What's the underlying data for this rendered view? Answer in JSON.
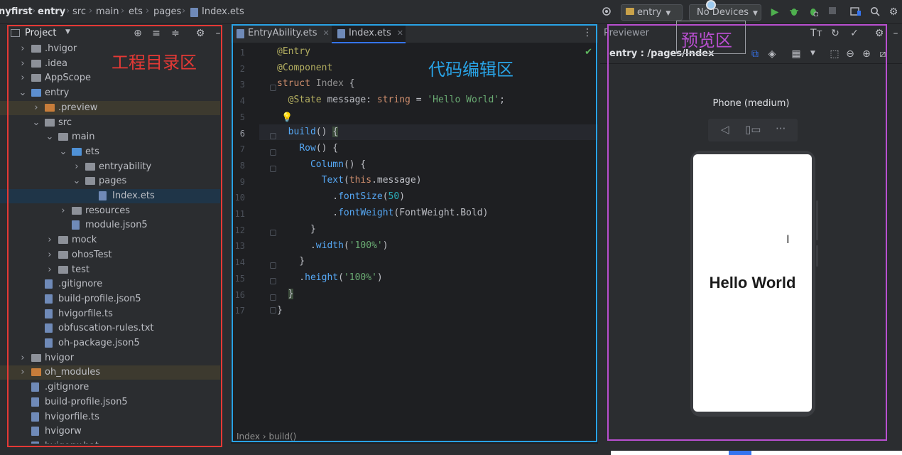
{
  "breadcrumb": {
    "items": [
      "nyfirst",
      "entry",
      "src",
      "main",
      "ets",
      "pages",
      "Index.ets"
    ]
  },
  "toolbar": {
    "module_combo": "entry",
    "device_combo": "No Devices"
  },
  "project_panel": {
    "title": "Project",
    "tree": [
      {
        "label": ".hvigor",
        "kind": "folder",
        "expanded": false,
        "depth": 1
      },
      {
        "label": ".idea",
        "kind": "folder",
        "expanded": false,
        "depth": 1
      },
      {
        "label": "AppScope",
        "kind": "folder",
        "expanded": false,
        "depth": 1
      },
      {
        "label": "entry",
        "kind": "module",
        "expanded": true,
        "depth": 1
      },
      {
        "label": ".preview",
        "kind": "folder-orange",
        "expanded": false,
        "depth": 2,
        "highlight": "orange"
      },
      {
        "label": "src",
        "kind": "folder",
        "expanded": true,
        "depth": 2
      },
      {
        "label": "main",
        "kind": "folder",
        "expanded": true,
        "depth": 3
      },
      {
        "label": "ets",
        "kind": "folder-blue",
        "expanded": true,
        "depth": 4
      },
      {
        "label": "entryability",
        "kind": "folder",
        "expanded": false,
        "depth": 5
      },
      {
        "label": "pages",
        "kind": "folder",
        "expanded": true,
        "depth": 5
      },
      {
        "label": "Index.ets",
        "kind": "file",
        "depth": 6,
        "highlight": "selected"
      },
      {
        "label": "resources",
        "kind": "folder",
        "expanded": false,
        "depth": 4
      },
      {
        "label": "module.json5",
        "kind": "file",
        "depth": 4
      },
      {
        "label": "mock",
        "kind": "folder",
        "expanded": false,
        "depth": 3
      },
      {
        "label": "ohosTest",
        "kind": "folder",
        "expanded": false,
        "depth": 3
      },
      {
        "label": "test",
        "kind": "folder",
        "expanded": false,
        "depth": 3
      },
      {
        "label": ".gitignore",
        "kind": "file",
        "depth": 2
      },
      {
        "label": "build-profile.json5",
        "kind": "file",
        "depth": 2
      },
      {
        "label": "hvigorfile.ts",
        "kind": "file",
        "depth": 2
      },
      {
        "label": "obfuscation-rules.txt",
        "kind": "file",
        "depth": 2
      },
      {
        "label": "oh-package.json5",
        "kind": "file",
        "depth": 2
      },
      {
        "label": "hvigor",
        "kind": "folder",
        "expanded": false,
        "depth": 1
      },
      {
        "label": "oh_modules",
        "kind": "folder-orange",
        "expanded": false,
        "depth": 1,
        "highlight": "orange"
      },
      {
        "label": ".gitignore",
        "kind": "file",
        "depth": 1
      },
      {
        "label": "build-profile.json5",
        "kind": "file",
        "depth": 1
      },
      {
        "label": "hvigorfile.ts",
        "kind": "file",
        "depth": 1
      },
      {
        "label": "hvigorw",
        "kind": "file",
        "depth": 1
      },
      {
        "label": "hvigorw.bat",
        "kind": "file",
        "depth": 1
      }
    ]
  },
  "editor": {
    "tabs": [
      {
        "label": "EntryAbility.ets",
        "active": false
      },
      {
        "label": "Index.ets",
        "active": true
      }
    ],
    "line_numbers": [
      "1",
      "2",
      "3",
      "4",
      "5",
      "6",
      "7",
      "8",
      "9",
      "10",
      "11",
      "12",
      "13",
      "14",
      "15",
      "16",
      "17"
    ],
    "code": {
      "l1": "@Entry",
      "l2": "@Component",
      "l3_kw": "struct",
      "l3_name": "Index",
      "l3_brace": "{",
      "l4_dec": "@State",
      "l4_field": "message",
      "l4_type": "string",
      "l4_str": "'Hello World'",
      "l6_fn": "build",
      "l7_fn": "Row",
      "l8_fn": "Column",
      "l9_fn": "Text",
      "l9_kw": "this",
      "l9_field": "message",
      "l10_fn": "fontSize",
      "l10_num": "50",
      "l11_fn": "fontWeight",
      "l11_arg": "FontWeight.Bold",
      "l13_fn": "width",
      "l13_str": "'100%'",
      "l15_fn": "height",
      "l15_str": "'100%'"
    },
    "status_crumbs": "Index  ›  build()"
  },
  "previewer": {
    "title": "Previewer",
    "path": "entry : /pages/Index",
    "device_name": "Phone (medium)",
    "screen_text": "Hello World"
  },
  "annotations": {
    "project_area": {
      "label": "工程目录区",
      "color": "#e53935"
    },
    "editor_area": {
      "label": "代码编辑区",
      "color": "#29a3e6"
    },
    "preview_area": {
      "label": "预览区",
      "color": "#b94fd0"
    }
  },
  "colors": {
    "accent": "#3574f0",
    "run_green": "#4fb04f",
    "check_green": "#5fb85f"
  }
}
